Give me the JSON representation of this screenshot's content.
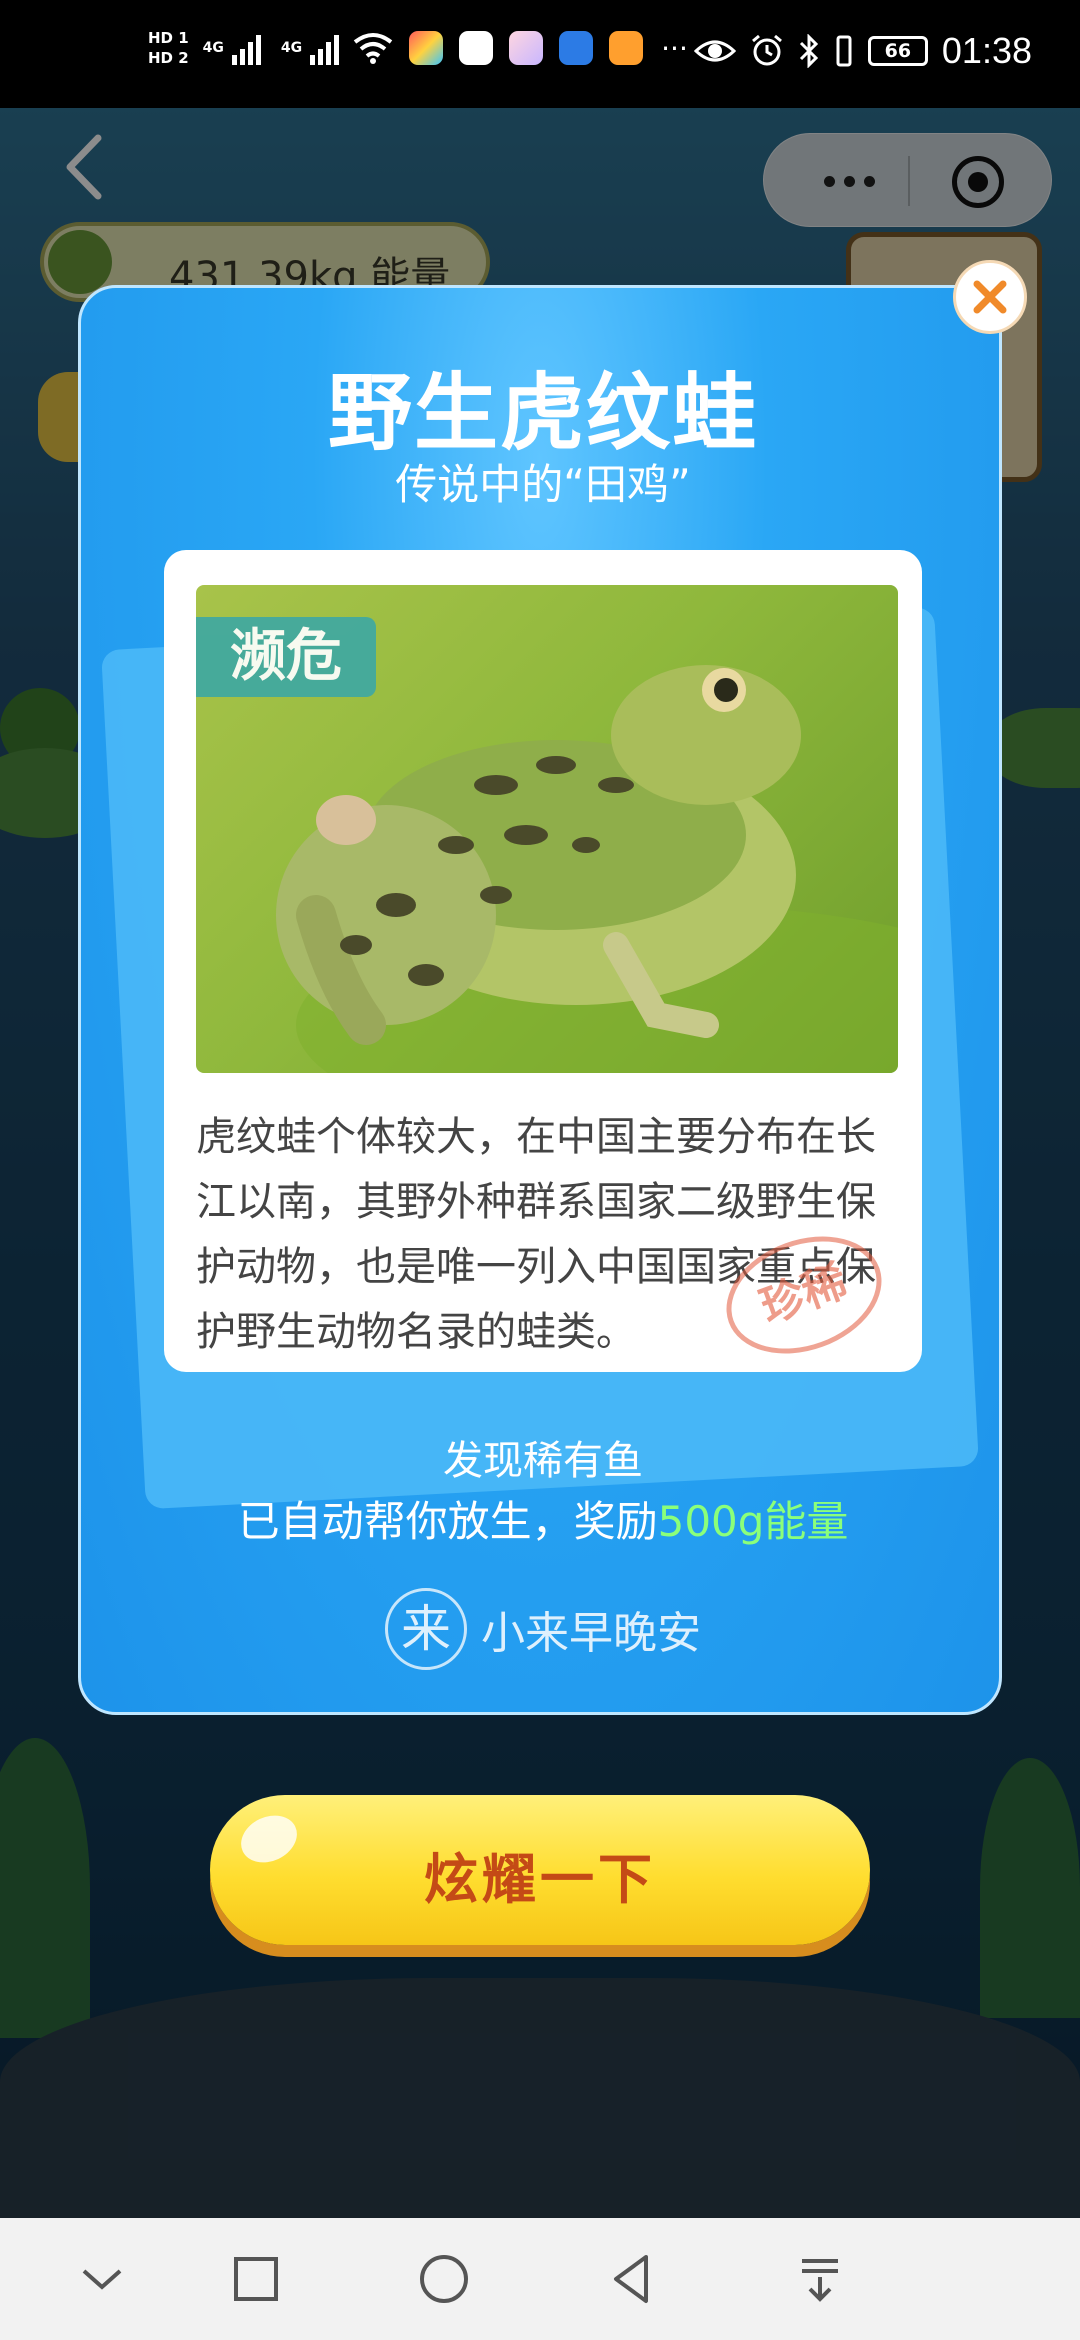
{
  "status_bar": {
    "sim1": "HD 1",
    "sim2": "HD 2",
    "network": "4G",
    "battery": "66",
    "time": "01:38",
    "more": "···"
  },
  "game": {
    "energy_text": "431.39kg 能量"
  },
  "modal": {
    "title": "野生虎纹蛙",
    "subtitle": "传说中的“田鸡”",
    "status_tag": "濒危",
    "description": "虎纹蛙个体较大，在中国主要分布在长江以南，其野外种群系国家二级野生保护动物，也是唯一列入中国国家重点保护野生动物名录的蛙类。",
    "stamp": "珍稀",
    "found_text": "发现稀有鱼",
    "reward_prefix": "已自动帮你放生，奖励",
    "reward_value": "500g能量",
    "brand_logo": "来",
    "brand_name": "小来早晚安"
  },
  "share_button": {
    "label": "炫耀一下"
  },
  "colors": {
    "modal_blue": "#2aa7f5",
    "reward_green": "#8bff7a",
    "button_yellow": "#ffdd2f",
    "button_text": "#c44a16",
    "close_orange": "#f08a2a"
  }
}
